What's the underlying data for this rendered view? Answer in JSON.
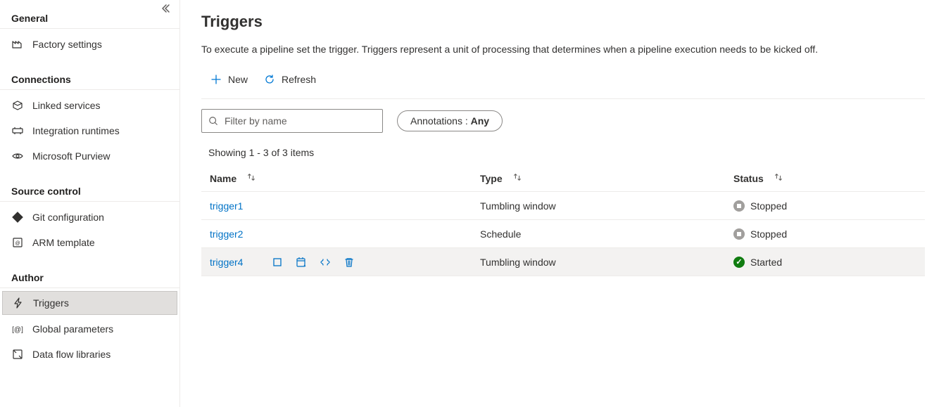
{
  "sidebar": {
    "sections": [
      {
        "title": "General",
        "items": [
          {
            "label": "Factory settings",
            "name": "factory-settings"
          }
        ]
      },
      {
        "title": "Connections",
        "items": [
          {
            "label": "Linked services",
            "name": "linked-services"
          },
          {
            "label": "Integration runtimes",
            "name": "integration-runtimes"
          },
          {
            "label": "Microsoft Purview",
            "name": "microsoft-purview"
          }
        ]
      },
      {
        "title": "Source control",
        "items": [
          {
            "label": "Git configuration",
            "name": "git-configuration"
          },
          {
            "label": "ARM template",
            "name": "arm-template"
          }
        ]
      },
      {
        "title": "Author",
        "items": [
          {
            "label": "Triggers",
            "name": "triggers",
            "active": true
          },
          {
            "label": "Global parameters",
            "name": "global-parameters"
          },
          {
            "label": "Data flow libraries",
            "name": "data-flow-libraries"
          }
        ]
      }
    ]
  },
  "page": {
    "title": "Triggers",
    "description": "To execute a pipeline set the trigger. Triggers represent a unit of processing that determines when a pipeline execution needs to be kicked off."
  },
  "toolbar": {
    "new_label": "New",
    "refresh_label": "Refresh"
  },
  "filter": {
    "placeholder": "Filter by name",
    "annotations_label": "Annotations : ",
    "annotations_value": "Any"
  },
  "showing_text": "Showing 1 - 3 of 3 items",
  "columns": {
    "name": "Name",
    "type": "Type",
    "status": "Status"
  },
  "rows": [
    {
      "name": "trigger1",
      "type": "Tumbling window",
      "status": "Stopped",
      "hovered": false
    },
    {
      "name": "trigger2",
      "type": "Schedule",
      "status": "Stopped",
      "hovered": false
    },
    {
      "name": "trigger4",
      "type": "Tumbling window",
      "status": "Started",
      "hovered": true
    }
  ]
}
